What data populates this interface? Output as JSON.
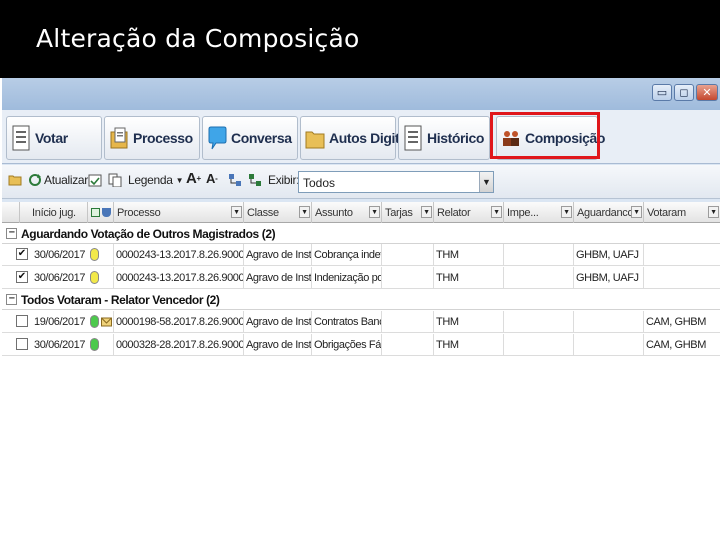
{
  "slide": {
    "title": "Alteração da Composição"
  },
  "window": {
    "minimize_glyph": "▭",
    "maximize_glyph": "◻",
    "close_glyph": "✕"
  },
  "tabs": [
    {
      "label": "Votar",
      "icon": "document-list-icon"
    },
    {
      "label": "Processo",
      "icon": "folder-document-icon"
    },
    {
      "label": "Conversa",
      "icon": "speech-bubble-icon"
    },
    {
      "label": "Autos Digitais",
      "icon": "folder-icon"
    },
    {
      "label": "Histórico",
      "icon": "document-list-icon"
    },
    {
      "label": "Composição",
      "icon": "people-icon"
    }
  ],
  "toolbar": {
    "refresh_label": "Atualizar",
    "legend_label": "Legenda",
    "filter_label": "Exibir:",
    "filter_value": "Todos",
    "font_up_glyph": "A",
    "font_down_glyph": "A"
  },
  "columns": [
    "Início jug.",
    "Processo",
    "Classe",
    "Assunto",
    "Tarjas",
    "Relator",
    "Impe...",
    "Aguardanco.",
    "Votaram"
  ],
  "groups": [
    {
      "label": "Aguardando Votação de Outros Magistrados (2)",
      "rows": [
        {
          "checked": true,
          "date": "30/06/2017",
          "status": "yellow",
          "processo": "0000243-13.2017.8.26.9000",
          "classe": "Agravo de Instrumento",
          "assunto": "Cobrança indevida",
          "relator": "THM",
          "aguardando": "GHBM, UAFJ",
          "votaram": ""
        },
        {
          "checked": true,
          "date": "30/06/2017",
          "status": "yellow",
          "processo": "0000243-13.2017.8.26.9000",
          "classe": "Agravo de Instrumento",
          "assunto": "Indenização por Da",
          "relator": "THM",
          "aguardando": "GHBM, UAFJ",
          "votaram": ""
        }
      ]
    },
    {
      "label": "Todos Votaram - Relator Vencedor (2)",
      "rows": [
        {
          "checked": false,
          "date": "19/06/2017",
          "status": "green",
          "envelope": true,
          "processo": "0000198-58.2017.8.26.9000",
          "classe": "Agravo de Instrumento",
          "assunto": "Contratos Bancários",
          "relator": "THM",
          "aguardando": "",
          "votaram": "CAM, GHBM"
        },
        {
          "checked": false,
          "date": "30/06/2017",
          "status": "green",
          "envelope": false,
          "processo": "0000328-28.2017.8.26.9000",
          "classe": "Agravo de Instrumento",
          "assunto": "Obrigações Fálq",
          "relator": "THM",
          "aguardando": "",
          "votaram": "CAM, GHBM"
        }
      ]
    }
  ],
  "colors": {
    "highlight": "#e0161b",
    "yellow": "#f2e94a",
    "green": "#4cc94c"
  }
}
